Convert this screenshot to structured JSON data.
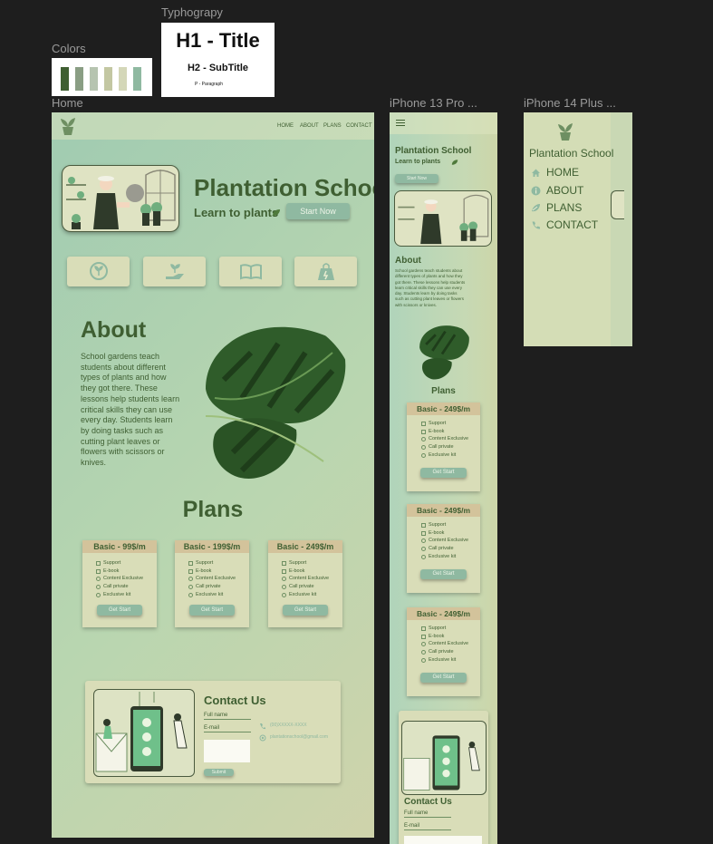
{
  "canvas": {
    "labels": {
      "colors": "Colors",
      "typography": "Typhograpy",
      "home": "Home",
      "iphone13": "iPhone 13 Pro ...",
      "iphone14": "iPhone 14 Plus ..."
    },
    "swatches": [
      "#3f5f32",
      "#8a9e84",
      "#b6c4b0",
      "#c3c7a2",
      "#d4d7b8",
      "#8fb9a1"
    ],
    "typography": {
      "h1": "H1 - Title",
      "h2": "H2 - SubTitle",
      "p": "P - Paragraph"
    }
  },
  "home": {
    "nav": [
      "HOME",
      "ABOUT",
      "PLANS",
      "CONTACT"
    ],
    "hero": {
      "title": "Plantation School",
      "subtitle": "Learn to plants",
      "cta": "Start Now"
    },
    "feature_icons": [
      "plant-badge-icon",
      "hand-sprout-icon",
      "book-icon",
      "bag-icon"
    ],
    "about": {
      "title": "About",
      "text": "School gardens teach students about different types of plants and how they got there. These lessons help students learn critical skills they can use every day. Students learn by doing tasks such as cutting plant leaves or flowers with scissors or knives."
    },
    "plans": {
      "title": "Plans",
      "items": [
        {
          "name": "Basic - 99$/m",
          "button": "Get Start"
        },
        {
          "name": "Basic - 199$/m",
          "button": "Get Start"
        },
        {
          "name": "Basic - 249$/m",
          "button": "Get Start"
        }
      ],
      "features": [
        "Support",
        "E-book",
        "Content Exclusive",
        "Call private",
        "Exclusive kit"
      ]
    },
    "contact": {
      "title": "Contact Us",
      "full_name_label": "Full name",
      "email_label": "E-mail",
      "submit": "Submit",
      "phone": "(00)XXXXX-XXXX",
      "email": "plantationschool@gmail.com"
    }
  },
  "iphone13": {
    "title": "Plantation School",
    "subtitle": "Learn to plants",
    "cta": "Start Now",
    "about_title": "About",
    "about_text": "School gardens teach students about different types of plants and how they got there. These lessons help students learn critical skills they can use every day. Students learn by doing tasks such as cutting plant leaves or flowers with scissors or knives.",
    "plans_title": "Plans",
    "plans": [
      {
        "name": "Basic - 249$/m",
        "button": "Get Start"
      },
      {
        "name": "Basic - 249$/m",
        "button": "Get Start"
      },
      {
        "name": "Basic - 249$/m",
        "button": "Get Start"
      }
    ],
    "contact_title": "Contact Us",
    "full_name_label": "Full name",
    "email_label": "E-mail"
  },
  "iphone14": {
    "title": "Plantation School",
    "menu": [
      {
        "label": "HOME",
        "icon": "home-icon"
      },
      {
        "label": "ABOUT",
        "icon": "info-icon"
      },
      {
        "label": "PLANS",
        "icon": "plans-icon"
      },
      {
        "label": "CONTACT",
        "icon": "phone-icon"
      }
    ]
  }
}
